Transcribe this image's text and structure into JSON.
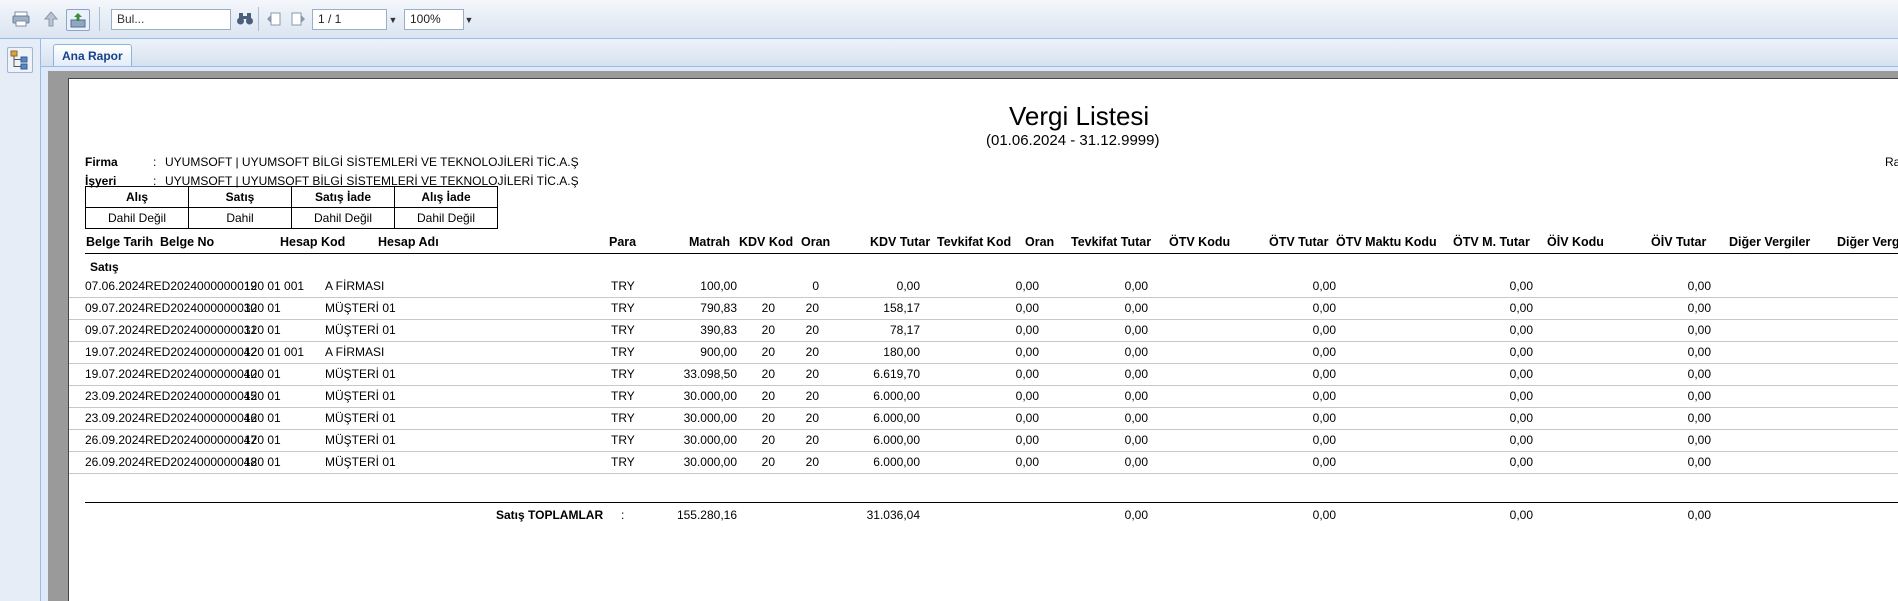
{
  "toolbar": {
    "search_placeholder": "Bul...",
    "page_indicator": "1 / 1",
    "zoom": "100%"
  },
  "tab": {
    "label": "Ana Rapor"
  },
  "report": {
    "title": "Vergi Listesi",
    "date_range": "(01.06.2024 - 31.12.9999)",
    "firma_label": "Firma",
    "firma_value": "UYUMSOFT | UYUMSOFT BİLGİ SİSTEMLERİ VE TEKNOLOJİLERİ TİC.A.Ş",
    "isyeri_label": "İşyeri",
    "isyeri_value": "UYUMSOFT | UYUMSOFT BİLGİ SİSTEMLERİ VE TEKNOLOJİLERİ TİC.A.Ş",
    "colon": ":",
    "right_edge_text": "Ra",
    "tax_types": {
      "headers": [
        "Alış",
        "Satış",
        "Satış İade",
        "Alış İade"
      ],
      "values": [
        "Dahil Değil",
        "Dahil",
        "Dahil Değil",
        "Dahil Değil"
      ]
    },
    "columns": [
      "Belge Tarih",
      "Belge No",
      "Hesap Kod",
      "Hesap Adı",
      "Para",
      "Matrah",
      "KDV Kod",
      "Oran",
      "KDV Tutar",
      "Tevkifat Kod",
      "Oran",
      "Tevkifat Tutar",
      "ÖTV Kodu",
      "ÖTV Tutar",
      "ÖTV Maktu Kodu",
      "ÖTV M. Tutar",
      "ÖİV Kodu",
      "ÖİV Tutar",
      "Diğer Vergiler",
      "Diğer Vergi"
    ],
    "group_label": "Satış",
    "rows": [
      {
        "tarih": "07.06.2024",
        "no": "RED2024000000019",
        "kod": "120 01 001",
        "ad": "A FİRMASI",
        "para": "TRY",
        "matrah": "100,00",
        "kdvkod": "",
        "oran": "0",
        "kdvtutar": "0,00",
        "tevoran": "0,00",
        "tevtutar": "0,00",
        "otvtutar": "0,00",
        "otvm": "0,00",
        "oiv": "0,00"
      },
      {
        "tarih": "09.07.2024",
        "no": "RED2024000000030",
        "kod": "120 01",
        "ad": "MÜŞTERİ 01",
        "para": "TRY",
        "matrah": "790,83",
        "kdvkod": "20",
        "oran": "20",
        "kdvtutar": "158,17",
        "tevoran": "0,00",
        "tevtutar": "0,00",
        "otvtutar": "0,00",
        "otvm": "0,00",
        "oiv": "0,00"
      },
      {
        "tarih": "09.07.2024",
        "no": "RED2024000000031",
        "kod": "120 01",
        "ad": "MÜŞTERİ 01",
        "para": "TRY",
        "matrah": "390,83",
        "kdvkod": "20",
        "oran": "20",
        "kdvtutar": "78,17",
        "tevoran": "0,00",
        "tevtutar": "0,00",
        "otvtutar": "0,00",
        "otvm": "0,00",
        "oiv": "0,00"
      },
      {
        "tarih": "19.07.2024",
        "no": "RED2024000000042",
        "kod": "120 01 001",
        "ad": "A FİRMASI",
        "para": "TRY",
        "matrah": "900,00",
        "kdvkod": "20",
        "oran": "20",
        "kdvtutar": "180,00",
        "tevoran": "0,00",
        "tevtutar": "0,00",
        "otvtutar": "0,00",
        "otvm": "0,00",
        "oiv": "0,00"
      },
      {
        "tarih": "19.07.2024",
        "no": "RED2024000000040",
        "kod": "120 01",
        "ad": "MÜŞTERİ 01",
        "para": "TRY",
        "matrah": "33.098,50",
        "kdvkod": "20",
        "oran": "20",
        "kdvtutar": "6.619,70",
        "tevoran": "0,00",
        "tevtutar": "0,00",
        "otvtutar": "0,00",
        "otvm": "0,00",
        "oiv": "0,00"
      },
      {
        "tarih": "23.09.2024",
        "no": "RED2024000000045",
        "kod": "120 01",
        "ad": "MÜŞTERİ 01",
        "para": "TRY",
        "matrah": "30.000,00",
        "kdvkod": "20",
        "oran": "20",
        "kdvtutar": "6.000,00",
        "tevoran": "0,00",
        "tevtutar": "0,00",
        "otvtutar": "0,00",
        "otvm": "0,00",
        "oiv": "0,00"
      },
      {
        "tarih": "23.09.2024",
        "no": "RED2024000000046",
        "kod": "120 01",
        "ad": "MÜŞTERİ 01",
        "para": "TRY",
        "matrah": "30.000,00",
        "kdvkod": "20",
        "oran": "20",
        "kdvtutar": "6.000,00",
        "tevoran": "0,00",
        "tevtutar": "0,00",
        "otvtutar": "0,00",
        "otvm": "0,00",
        "oiv": "0,00"
      },
      {
        "tarih": "26.09.2024",
        "no": "RED2024000000047",
        "kod": "120 01",
        "ad": "MÜŞTERİ 01",
        "para": "TRY",
        "matrah": "30.000,00",
        "kdvkod": "20",
        "oran": "20",
        "kdvtutar": "6.000,00",
        "tevoran": "0,00",
        "tevtutar": "0,00",
        "otvtutar": "0,00",
        "otvm": "0,00",
        "oiv": "0,00"
      },
      {
        "tarih": "26.09.2024",
        "no": "RED2024000000048",
        "kod": "120 01",
        "ad": "MÜŞTERİ 01",
        "para": "TRY",
        "matrah": "30.000,00",
        "kdvkod": "20",
        "oran": "20",
        "kdvtutar": "6.000,00",
        "tevoran": "0,00",
        "tevtutar": "0,00",
        "otvtutar": "0,00",
        "otvm": "0,00",
        "oiv": "0,00"
      }
    ],
    "totals": {
      "label": "Satış TOPLAMLAR",
      "colon": ":",
      "matrah": "155.280,16",
      "kdvtutar": "31.036,04",
      "tevtutar": "0,00",
      "otvtutar": "0,00",
      "otvm": "0,00",
      "oiv": "0,00"
    }
  }
}
